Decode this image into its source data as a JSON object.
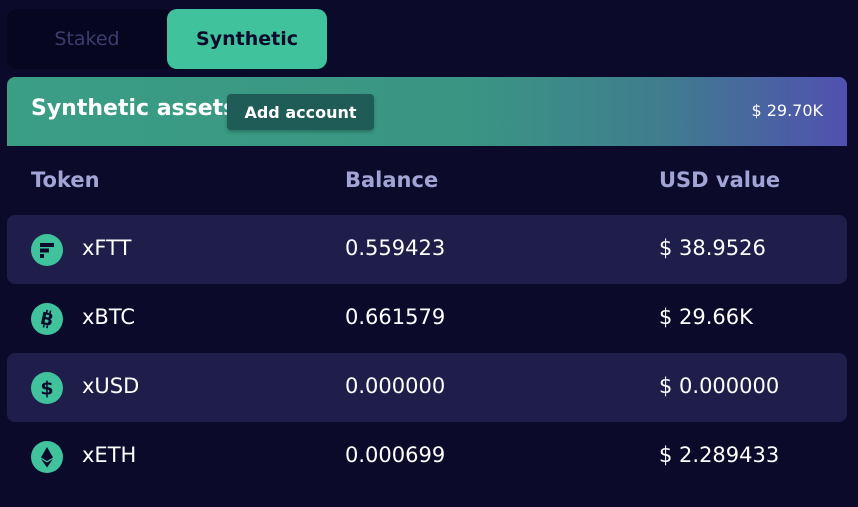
{
  "tabs": {
    "staked": "Staked",
    "synthetic": "Synthetic",
    "active": "Synthetic"
  },
  "header": {
    "title": "Synthetic assets",
    "add_button": "Add account",
    "total": "$ 29.70K"
  },
  "columns": {
    "token": "Token",
    "balance": "Balance",
    "usd": "USD value"
  },
  "rows": [
    {
      "token": "xFTT",
      "icon": "ftt-icon",
      "balance": "0.559423",
      "usd": "$ 38.9526"
    },
    {
      "token": "xBTC",
      "icon": "btc-icon",
      "balance": "0.661579",
      "usd": "$ 29.66K"
    },
    {
      "token": "xUSD",
      "icon": "usd-icon",
      "balance": "0.000000",
      "usd": "$ 0.000000"
    },
    {
      "token": "xETH",
      "icon": "eth-icon",
      "balance": "0.000699",
      "usd": "$ 2.289433"
    }
  ],
  "colors": {
    "accent": "#40c29c",
    "background": "#0b0a2b",
    "row_shade": "#1f1e4a",
    "header_text": "#a3a4d6"
  }
}
